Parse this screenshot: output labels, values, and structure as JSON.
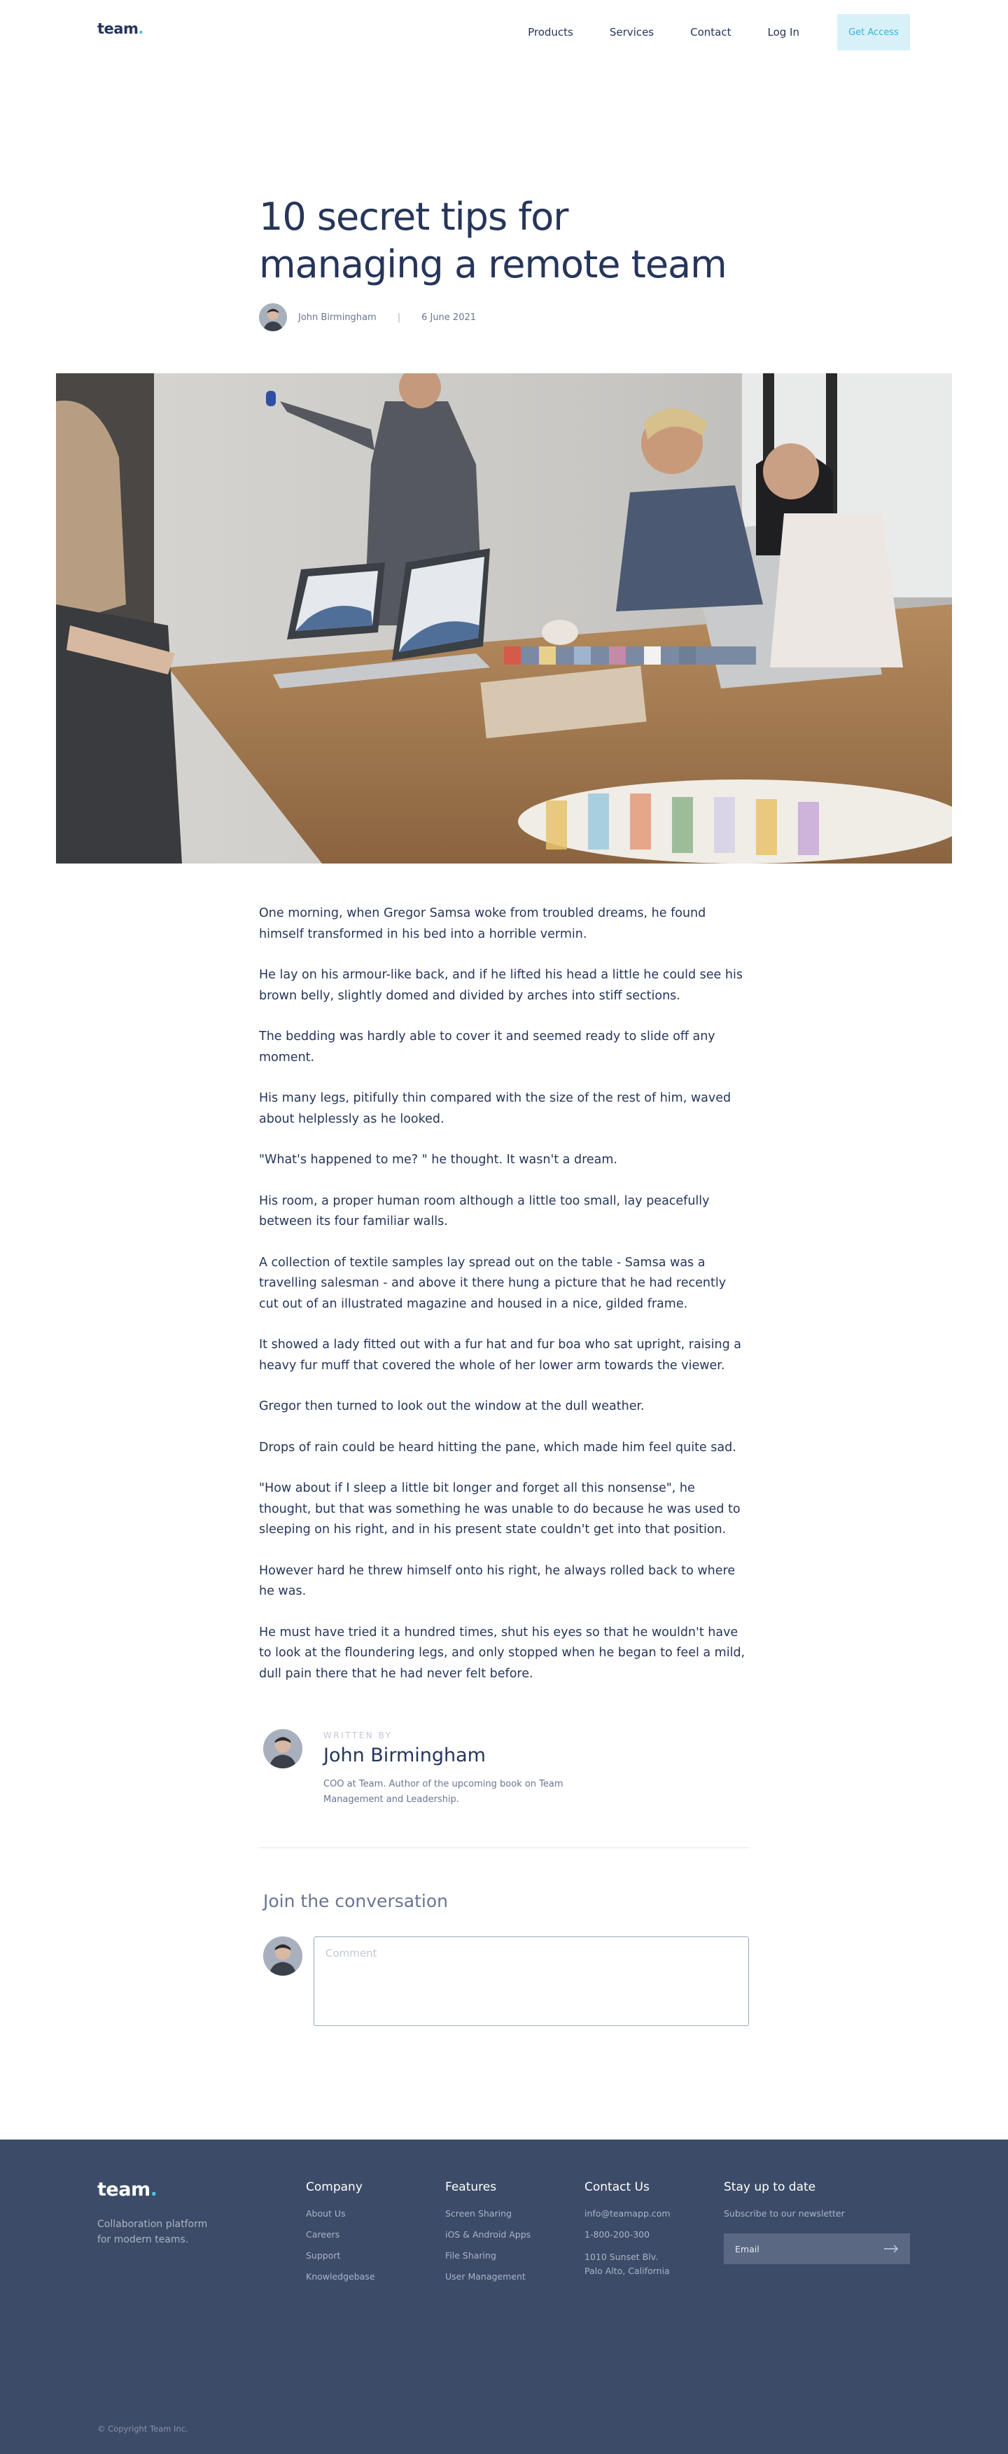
{
  "nav": {
    "logo": "team",
    "logo_dot": ".",
    "links": [
      "Products",
      "Services",
      "Contact",
      "Log In"
    ],
    "cta": "Get Access"
  },
  "post": {
    "title": "10 secret tips for managing a remote team",
    "author": "John Birmingham",
    "separator": "|",
    "date": "6 June 2021",
    "paragraphs": [
      "One morning, when Gregor Samsa woke from troubled dreams, he found himself transformed in his bed into a horrible vermin.",
      "He lay on his armour-like back, and if he lifted his head a little he could see his brown belly, slightly domed and divided by arches into stiff sections.",
      "The bedding was hardly able to cover it and seemed ready to slide off any moment.",
      "His many legs, pitifully thin compared with the size of the rest of him, waved about helplessly as he looked.",
      "\"What's happened to me? \" he thought. It wasn't a dream.",
      "His room, a proper human room although a little too small, lay peacefully between its four familiar walls.",
      "A collection of textile samples lay spread out on the table - Samsa was a travelling salesman - and above it there hung a picture that he had recently cut out of an illustrated magazine and housed in a nice, gilded frame.",
      "It showed a lady fitted out with a fur hat and fur boa who sat upright, raising a heavy fur muff that covered the whole of her lower arm towards the viewer.",
      "Gregor then turned to look out the window at the dull weather.",
      "Drops of rain could be heard hitting the pane, which made him feel quite sad.",
      "\"How about if I sleep a little bit longer and forget all this nonsense\", he thought, but that was something he was unable to do because he was used to sleeping on his right, and in his present state couldn't get into that position.",
      "However hard he threw himself onto his right, he always rolled back to where he was.",
      "He must have tried it a hundred times, shut his eyes so that he wouldn't have to look at the floundering legs, and only stopped when he began to feel a mild, dull pain there that he had never felt before."
    ]
  },
  "author_box": {
    "label": "WRITTEN BY",
    "name": "John Birmingham",
    "bio": "COO at Team. Author of the upcoming book on Team Management and Leadership."
  },
  "conversation": {
    "title": "Join the conversation",
    "placeholder": "Comment"
  },
  "footer": {
    "logo": "team",
    "logo_dot": ".",
    "tagline": "Collaboration platform for modern teams.",
    "company": {
      "title": "Company",
      "links": [
        "About Us",
        "Careers",
        "Support",
        "Knowledgebase"
      ]
    },
    "features": {
      "title": "Features",
      "links": [
        "Screen Sharing",
        "iOS & Android Apps",
        "File Sharing",
        "User Management"
      ]
    },
    "contact": {
      "title": "Contact Us",
      "email": "info@teamapp.com",
      "phone": "1-800-200-300",
      "address_line1": "1010 Sunset Blv.",
      "address_line2": "Palo Alto, California"
    },
    "newsletter": {
      "title": "Stay up to date",
      "subtitle": "Subscribe to our newsletter",
      "placeholder": "Email"
    },
    "copyright": "© Copyright Team Inc."
  },
  "colors": {
    "brand_navy": "#26355a",
    "accent_cyan": "#4ec3e0",
    "cta_bg": "#d7f1f9",
    "footer_bg": "#3c4b67"
  },
  "icons": [
    "author-avatar",
    "arrow-right-icon",
    "resize-handle-icon"
  ]
}
